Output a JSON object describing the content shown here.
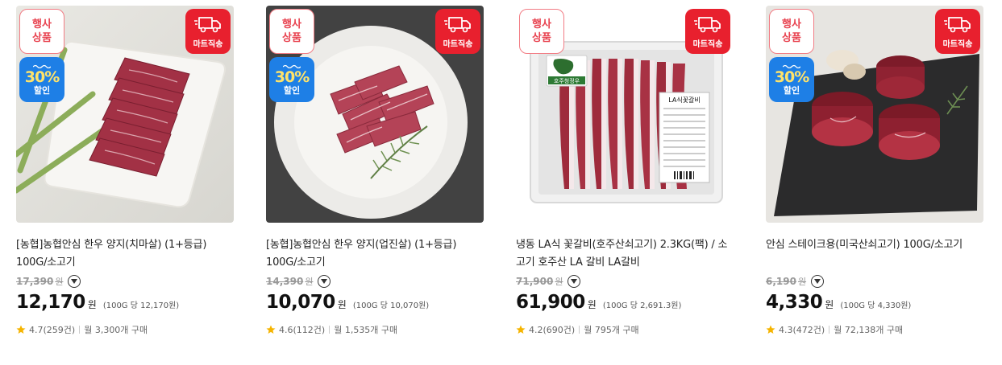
{
  "badges": {
    "event": [
      "행사",
      "상품"
    ],
    "mart": "마트직송",
    "discount_pct": "30%",
    "discount_label": "할인"
  },
  "colors": {
    "event_text": "#e8424f",
    "mart_bg": "#e8202e",
    "discount_bg": "#1e7fe6",
    "discount_pct": "#ffe36a",
    "star": "#f5b400"
  },
  "products": [
    {
      "title": "[농협]농협안심 한우 양지(치마살) (1+등급) 100G/소고기",
      "original_price": "17,390",
      "original_won": "원",
      "price": "12,170",
      "won": "원",
      "unit_price": "(100G 당 12,170원)",
      "rating": "4.7(259건)",
      "monthly": "월 3,300개 구매",
      "has_discount_badge": true,
      "image_icon": "beef-slices-on-plate-with-asparagus"
    },
    {
      "title": "[농협]농협안심 한우 양지(업진살) (1+등급) 100G/소고기",
      "original_price": "14,390",
      "original_won": "원",
      "price": "10,070",
      "won": "원",
      "unit_price": "(100G 당 10,070원)",
      "rating": "4.6(112건)",
      "monthly": "월 1,535개 구매",
      "has_discount_badge": true,
      "image_icon": "beef-strips-on-round-plate-with-rosemary"
    },
    {
      "title": "냉동 LA식 꽃갈비(호주산쇠고기) 2.3KG(팩) / 소고기 호주산 LA 갈비 LA갈비",
      "original_price": "71,900",
      "original_won": "원",
      "price": "61,900",
      "won": "원",
      "unit_price": "(100G 당 2,691.3원)",
      "rating": "4.2(690건)",
      "monthly": "월 795개 구매",
      "has_discount_badge": false,
      "image_icon": "packaged-la-galbi-tray",
      "package_brand": "호주청정우",
      "package_label": "LA식꽃갈비"
    },
    {
      "title": "안심 스테이크용(미국산쇠고기) 100G/소고기",
      "original_price": "6,190",
      "original_won": "원",
      "price": "4,330",
      "won": "원",
      "unit_price": "(100G 당 4,330원)",
      "rating": "4.3(472건)",
      "monthly": "월 72,138개 구매",
      "has_discount_badge": true,
      "image_icon": "tenderloin-steaks-on-slate"
    }
  ]
}
